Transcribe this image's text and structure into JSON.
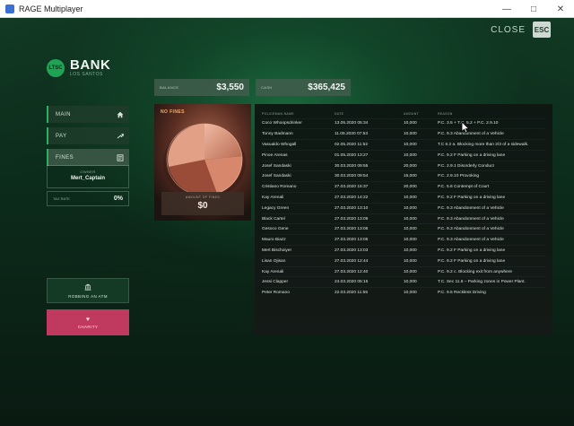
{
  "window": {
    "title": "RAGE Multiplayer"
  },
  "close": {
    "label": "CLOSE",
    "key": "ESC"
  },
  "brand": {
    "logo_text": "LTSC",
    "title": "BANK",
    "subtitle": "LOS SANTOS"
  },
  "nav": {
    "items": [
      {
        "label": "MAIN",
        "icon": "home-icon"
      },
      {
        "label": "PAY",
        "icon": "arrow-up-right-icon"
      },
      {
        "label": "FINES",
        "icon": "document-icon",
        "active": true
      }
    ]
  },
  "owner": {
    "caption": "OWNER",
    "name": "Mert_Captain"
  },
  "tax_rate": {
    "caption": "TAX RATE",
    "value": "0%"
  },
  "robbing": {
    "label": "ROBBING AN ATM",
    "icon": "bank-icon"
  },
  "charity": {
    "label": "CHARITY",
    "icon": "heart-icon"
  },
  "balance": {
    "caption": "BALANCE",
    "value": "$3,550"
  },
  "cash": {
    "caption": "CASH",
    "value": "$365,425"
  },
  "fines": {
    "label": "NO FINES",
    "total_caption": "AMOUNT OF FINES",
    "total_value": "$0"
  },
  "table": {
    "headers": [
      "POLICEMAN NAME",
      "DATE",
      "AMOUNT",
      "REASON"
    ],
    "rows": [
      [
        "Coco Whoopsdrinker",
        "13.05.2020 05:34",
        "10,000",
        "P.C. 3.5 + T.C. 5.2 + P.C. 2.9.10"
      ],
      [
        "Tonny Badmann",
        "11.05.2020 07:53",
        "10,000",
        "P.C. 9.3 Abandonment of a Vehicle"
      ],
      [
        "Vasualdo Whogall",
        "02.05.2020 11:52",
        "10,000",
        "T.C 6.2 a. Blocking more than 2/3 of a sidewalk."
      ],
      [
        "Pinoe Arenas",
        "01.05.2020 13:27",
        "10,000",
        "P.C. 9.2 F Parking on a driving lane"
      ],
      [
        "Josef Sandaski",
        "30.03.2020 09:55",
        "20,000",
        "P.C. 2.9.1 Disorderly Conduct"
      ],
      [
        "Josef Sandaski",
        "30.03.2020 09:54",
        "15,000",
        "P.C. 2.9.10 Provoking"
      ],
      [
        "Cristiano Romano",
        "27.03.2020 15:37",
        "20,000",
        "P.C. 5.6 Contempt of Court"
      ],
      [
        "Kay Arenali",
        "27.03.2020 14:22",
        "10,000",
        "P.C. 9.2 F Parking on a driving lane"
      ],
      [
        "Legacy Green",
        "27.03.2020 13:10",
        "10,000",
        "P.C. 9.3 Abandonment of a Vehicle"
      ],
      [
        "Black Cartel",
        "27.03.2020 13:09",
        "10,000",
        "P.C. 9.3 Abandonment of a Vehicle"
      ],
      [
        "Gesoco Gene",
        "27.03.2020 13:06",
        "10,000",
        "P.C. 9.3 Abandonment of a Vehicle"
      ],
      [
        "Mauro Biazz",
        "27.03.2020 13:05",
        "10,000",
        "P.C. 9.3 Abandonment of a Vehicle"
      ],
      [
        "Mert Bischoiyer",
        "27.03.2020 13:03",
        "10,000",
        "P.C. 9.2 F Parking on a driving lane"
      ],
      [
        "Lisan Ojisan",
        "27.03.2020 12:44",
        "10,000",
        "P.C. 9.2 F Parking on a driving lane"
      ],
      [
        "Kay Arenali",
        "27.03.2020 12:40",
        "10,000",
        "P.C. 9.2 c. Blocking exit from anywhere"
      ],
      [
        "Jessi Clapper",
        "24.03.2020 05:15",
        "10,000",
        "T.C. Sec 11.6 – Parking zones in Power Plant."
      ],
      [
        "Peter Romano",
        "22.03.2020 11:55",
        "10,000",
        "P.C. 9.5 Reckless Driving"
      ]
    ]
  },
  "colors": {
    "accent": "#2fae63",
    "charity": "#c0395e",
    "fines_label": "#ffb05a"
  }
}
